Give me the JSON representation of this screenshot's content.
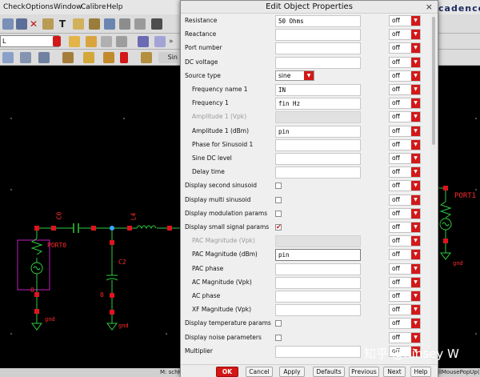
{
  "menubar": {
    "items": [
      "Check",
      "Options",
      "Window",
      "Calibre",
      "Help"
    ],
    "brand": "cadence"
  },
  "toolbar": {
    "cell_field_value": "L"
  },
  "schematic": {
    "labels": {
      "port0": "PORT0",
      "port1": "PORT1",
      "c0": "C0",
      "l4": "L4",
      "c2": "C2",
      "gnd_left": "gnd",
      "gnd_mid": "gnd",
      "gnd_right": "gnd",
      "zero_left": "0",
      "zero_mid": "0"
    }
  },
  "statusbar": {
    "left_text": "M: schH",
    "right_text": "llMousePopUp()"
  },
  "dialog": {
    "title": "Edit Object Properties",
    "close_glyph": "×",
    "rows": [
      {
        "label": "Resistance",
        "type": "field",
        "value": "50 Ohms",
        "off": "off"
      },
      {
        "label": "Reactance",
        "type": "field",
        "value": "",
        "off": "off"
      },
      {
        "label": "Port number",
        "type": "field",
        "value": "",
        "off": "off"
      },
      {
        "label": "DC voltage",
        "type": "field",
        "value": "",
        "off": "off"
      },
      {
        "label": "Source type",
        "type": "combo",
        "value": "sine",
        "off": "off"
      },
      {
        "label": "Frequency name 1",
        "type": "field",
        "value": "IN",
        "off": "off",
        "indent": true
      },
      {
        "label": "Frequency 1",
        "type": "field",
        "value": "fin Hz",
        "off": "off",
        "indent": true
      },
      {
        "label": "Amplitude 1 (Vpk)",
        "type": "field",
        "value": "",
        "off": "off",
        "indent": true,
        "disabled": true
      },
      {
        "label": "Amplitude 1 (dBm)",
        "type": "field",
        "value": "pin",
        "off": "off",
        "indent": true
      },
      {
        "label": "Phase for Sinusoid 1",
        "type": "field",
        "value": "",
        "off": "off",
        "indent": true
      },
      {
        "label": "Sine DC level",
        "type": "field",
        "value": "",
        "off": "off",
        "indent": true
      },
      {
        "label": "Delay time",
        "type": "field",
        "value": "",
        "off": "off",
        "indent": true
      },
      {
        "label": "Display second sinusoid",
        "type": "check",
        "checked": false,
        "off": "off"
      },
      {
        "label": "Display multi sinusoid",
        "type": "check",
        "checked": false,
        "off": "off"
      },
      {
        "label": "Display modulation params",
        "type": "check",
        "checked": false,
        "off": "off"
      },
      {
        "label": "Display small signal params",
        "type": "check",
        "checked": true,
        "off": "off"
      },
      {
        "label": "PAC Magnitude (Vpk)",
        "type": "field",
        "value": "",
        "off": "off",
        "indent": true,
        "disabled": true
      },
      {
        "label": "PAC Magnitude (dBm)",
        "type": "field",
        "value": "pin",
        "off": "off",
        "indent": true,
        "focus": true
      },
      {
        "label": "PAC phase",
        "type": "field",
        "value": "",
        "off": "off",
        "indent": true
      },
      {
        "label": "AC Magnitude (Vpk)",
        "type": "field",
        "value": "",
        "off": "off",
        "indent": true
      },
      {
        "label": "AC phase",
        "type": "field",
        "value": "",
        "off": "off",
        "indent": true
      },
      {
        "label": "XF Magnitude (Vpk)",
        "type": "field",
        "value": "",
        "off": "off",
        "indent": true
      },
      {
        "label": "Display temperature params",
        "type": "check",
        "checked": false,
        "off": "off"
      },
      {
        "label": "Display noise parameters",
        "type": "check",
        "checked": false,
        "off": "off"
      },
      {
        "label": "Multiplier",
        "type": "field",
        "value": "",
        "off": "off"
      }
    ],
    "buttons": {
      "ok": "OK",
      "cancel": "Cancel",
      "apply": "Apply",
      "defaults": "Defaults",
      "previous": "Previous",
      "next": "Next",
      "help": "Help"
    }
  },
  "watermark": "知乎 @Kinsey W",
  "colors": {
    "accent_red": "#d11919",
    "wire": "#2ecc40",
    "pin": "#e0141e",
    "label_red": "#ff2b2b",
    "instance_magenta": "#c11bc1",
    "node_blue": "#3da5ff"
  }
}
